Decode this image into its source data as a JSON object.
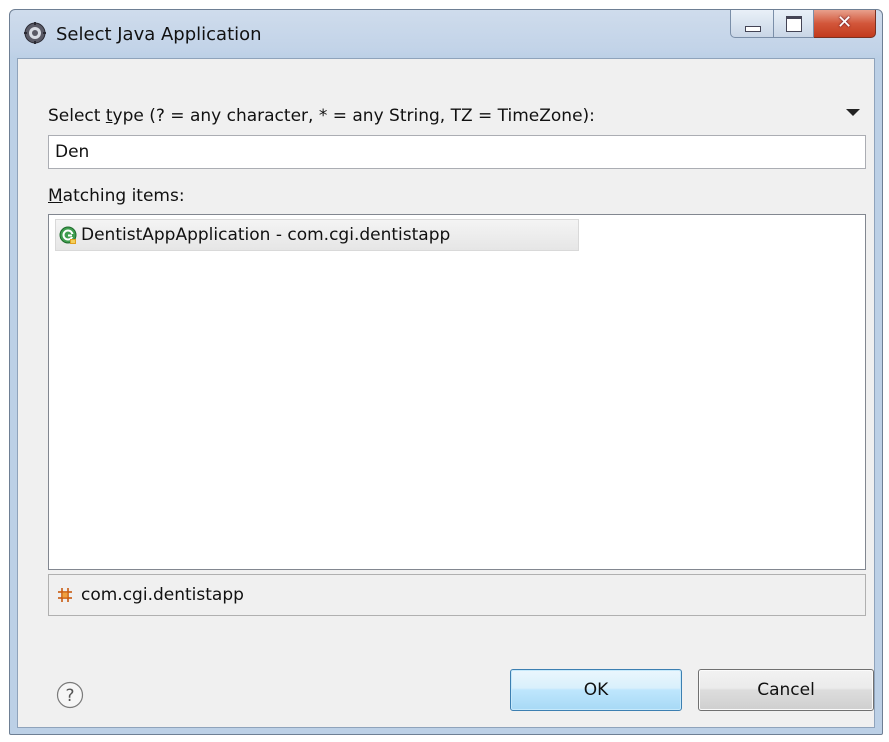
{
  "window": {
    "title": "Select Java Application"
  },
  "filter": {
    "label_prefix": "Select ",
    "label_mnemonic": "t",
    "label_rest": "ype (? = any character, * = any String, TZ = TimeZone):",
    "value": "Den"
  },
  "matching": {
    "label_mnemonic": "M",
    "label_rest": "atching items:",
    "items": [
      {
        "label": "DentistAppApplication - com.cgi.dentistapp",
        "icon": "java-application-icon"
      }
    ]
  },
  "details": {
    "package_label": "com.cgi.dentistapp",
    "icon": "package-icon"
  },
  "buttons": {
    "ok": "OK",
    "cancel": "Cancel"
  },
  "colors": {
    "ok_border": "#3c7fb1",
    "close_button": "#c23a1c"
  }
}
